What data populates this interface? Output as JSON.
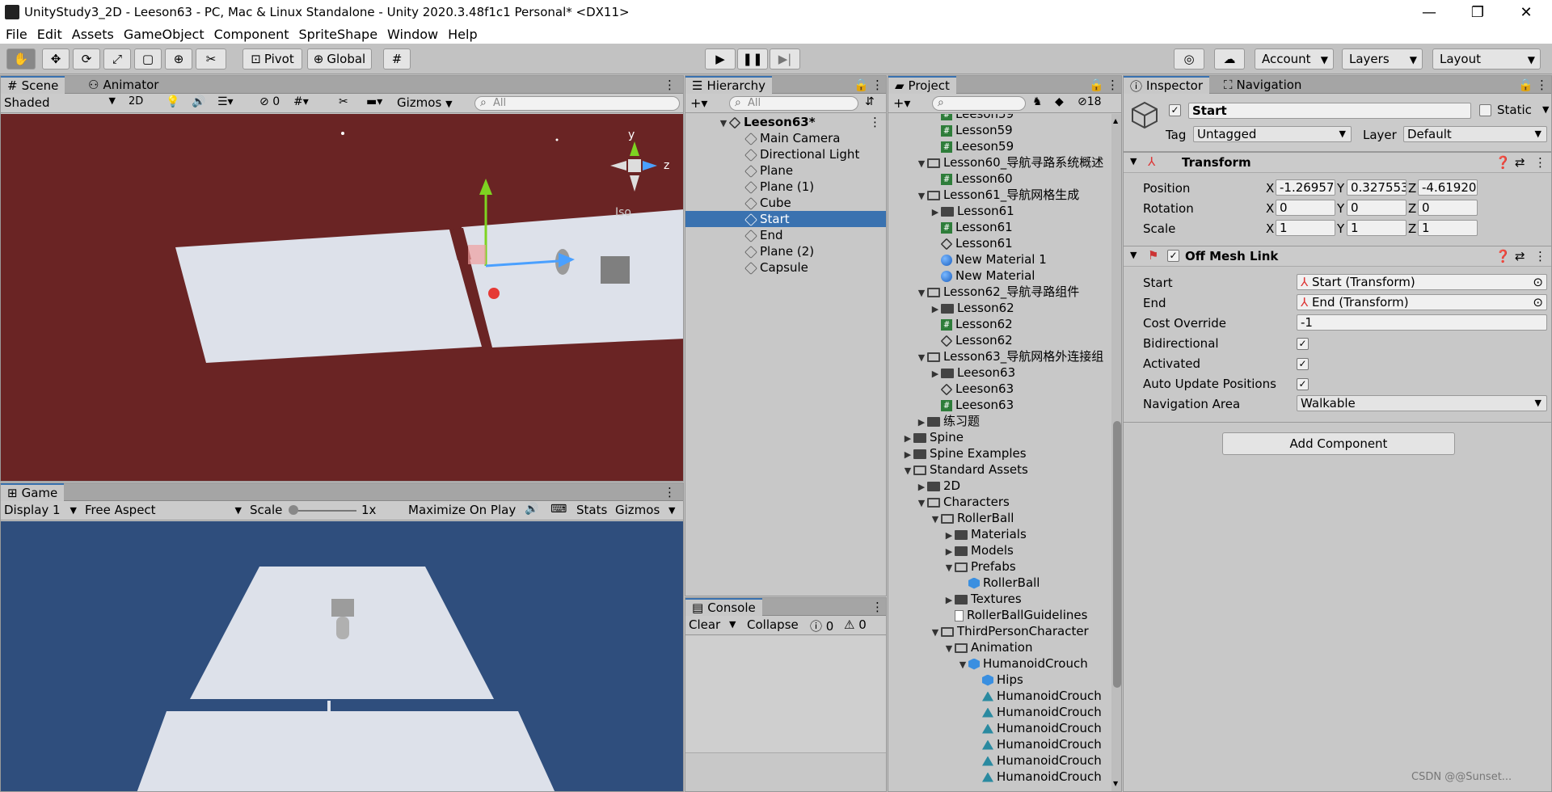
{
  "window": {
    "title": "UnityStudy3_2D - Leeson63 - PC, Mac & Linux Standalone - Unity 2020.3.48f1c1 Personal* <DX11>",
    "minimize": "—",
    "maximize": "❐",
    "close": "✕"
  },
  "menu": [
    "File",
    "Edit",
    "Assets",
    "GameObject",
    "Component",
    "SpriteShape",
    "Window",
    "Help"
  ],
  "toolbar": {
    "pivot": "Pivot",
    "global": "Global",
    "account": "Account",
    "layers": "Layers",
    "layout": "Layout"
  },
  "scene": {
    "tab_scene": "Scene",
    "tab_animator": "Animator",
    "shading": "Shaded",
    "mode2d": "2D",
    "fx_count": "0",
    "gizmos": "Gizmos",
    "search_placeholder": "All",
    "iso": "Iso",
    "axis_y": "y",
    "axis_z": "z",
    "bg_color": "#6a2424"
  },
  "game": {
    "tab": "Game",
    "display": "Display 1",
    "aspect": "Free Aspect",
    "scale_label": "Scale",
    "scale_value": "1x",
    "maximize": "Maximize On Play",
    "stats": "Stats",
    "gizmos": "Gizmos",
    "bg_color": "#2f4e7d"
  },
  "hierarchy": {
    "tab": "Hierarchy",
    "search_placeholder": "All",
    "scene_name": "Leeson63*",
    "items": [
      "Main Camera",
      "Directional Light",
      "Plane",
      "Plane (1)",
      "Cube",
      "Start",
      "End",
      "Plane (2)",
      "Capsule"
    ],
    "selected": "Start"
  },
  "console": {
    "tab": "Console",
    "clear": "Clear",
    "collapse": "Collapse",
    "errors": "0",
    "warnings": "0"
  },
  "project": {
    "tab": "Project",
    "hidden_count": "18",
    "items": [
      {
        "text": "Leeson59",
        "indent": 3,
        "icon": "ico-hash",
        "arrow": ""
      },
      {
        "text": "Lesson59",
        "indent": 3,
        "icon": "ico-hash",
        "arrow": ""
      },
      {
        "text": "Leeson59",
        "indent": 3,
        "icon": "ico-hash",
        "arrow": ""
      },
      {
        "text": "Lesson60_导航寻路系统概述",
        "indent": 2,
        "icon": "ico-folder open",
        "arrow": "▼"
      },
      {
        "text": "Lesson60",
        "indent": 3,
        "icon": "ico-hash",
        "arrow": ""
      },
      {
        "text": "Lesson61_导航网格生成",
        "indent": 2,
        "icon": "ico-folder open",
        "arrow": "▼"
      },
      {
        "text": "Lesson61",
        "indent": 3,
        "icon": "ico-folder",
        "arrow": "▶"
      },
      {
        "text": "Lesson61",
        "indent": 3,
        "icon": "ico-hash",
        "arrow": ""
      },
      {
        "text": "Lesson61",
        "indent": 3,
        "icon": "ico-unity",
        "arrow": ""
      },
      {
        "text": "New Material 1",
        "indent": 3,
        "icon": "ico-ball",
        "arrow": ""
      },
      {
        "text": "New Material",
        "indent": 3,
        "icon": "ico-ball",
        "arrow": ""
      },
      {
        "text": "Lesson62_导航寻路组件",
        "indent": 2,
        "icon": "ico-folder open",
        "arrow": "▼"
      },
      {
        "text": "Lesson62",
        "indent": 3,
        "icon": "ico-folder",
        "arrow": "▶"
      },
      {
        "text": "Lesson62",
        "indent": 3,
        "icon": "ico-hash",
        "arrow": ""
      },
      {
        "text": "Lesson62",
        "indent": 3,
        "icon": "ico-unity",
        "arrow": ""
      },
      {
        "text": "Lesson63_导航网格外连接组",
        "indent": 2,
        "icon": "ico-folder open",
        "arrow": "▼"
      },
      {
        "text": "Leeson63",
        "indent": 3,
        "icon": "ico-folder",
        "arrow": "▶"
      },
      {
        "text": "Leeson63",
        "indent": 3,
        "icon": "ico-unity",
        "arrow": ""
      },
      {
        "text": "Leeson63",
        "indent": 3,
        "icon": "ico-hash",
        "arrow": ""
      },
      {
        "text": "练习题",
        "indent": 2,
        "icon": "ico-folder",
        "arrow": "▶"
      },
      {
        "text": "Spine",
        "indent": 1,
        "icon": "ico-folder",
        "arrow": "▶"
      },
      {
        "text": "Spine Examples",
        "indent": 1,
        "icon": "ico-folder",
        "arrow": "▶"
      },
      {
        "text": "Standard Assets",
        "indent": 1,
        "icon": "ico-folder open",
        "arrow": "▼"
      },
      {
        "text": "2D",
        "indent": 2,
        "icon": "ico-folder",
        "arrow": "▶"
      },
      {
        "text": "Characters",
        "indent": 2,
        "icon": "ico-folder open",
        "arrow": "▼"
      },
      {
        "text": "RollerBall",
        "indent": 3,
        "icon": "ico-folder open",
        "arrow": "▼"
      },
      {
        "text": "Materials",
        "indent": 4,
        "icon": "ico-folder",
        "arrow": "▶"
      },
      {
        "text": "Models",
        "indent": 4,
        "icon": "ico-folder",
        "arrow": "▶"
      },
      {
        "text": "Prefabs",
        "indent": 4,
        "icon": "ico-folder open",
        "arrow": "▼"
      },
      {
        "text": "RollerBall",
        "indent": 5,
        "icon": "ico-prefab",
        "arrow": ""
      },
      {
        "text": "Textures",
        "indent": 4,
        "icon": "ico-folder",
        "arrow": "▶"
      },
      {
        "text": "RollerBallGuidelines",
        "indent": 4,
        "icon": "ico-doc",
        "arrow": ""
      },
      {
        "text": "ThirdPersonCharacter",
        "indent": 3,
        "icon": "ico-folder open",
        "arrow": "▼"
      },
      {
        "text": "Animation",
        "indent": 4,
        "icon": "ico-folder open",
        "arrow": "▼"
      },
      {
        "text": "HumanoidCrouch",
        "indent": 5,
        "icon": "ico-prefab",
        "arrow": "▼"
      },
      {
        "text": "Hips",
        "indent": 6,
        "icon": "ico-prefab",
        "arrow": ""
      },
      {
        "text": "HumanoidCrouch",
        "indent": 6,
        "icon": "ico-anim",
        "arrow": ""
      },
      {
        "text": "HumanoidCrouch",
        "indent": 6,
        "icon": "ico-anim",
        "arrow": ""
      },
      {
        "text": "HumanoidCrouch",
        "indent": 6,
        "icon": "ico-anim",
        "arrow": ""
      },
      {
        "text": "HumanoidCrouch",
        "indent": 6,
        "icon": "ico-anim",
        "arrow": ""
      },
      {
        "text": "HumanoidCrouch",
        "indent": 6,
        "icon": "ico-anim",
        "arrow": ""
      },
      {
        "text": "HumanoidCrouch",
        "indent": 6,
        "icon": "ico-anim",
        "arrow": ""
      }
    ]
  },
  "inspector": {
    "tab": "Inspector",
    "tab_nav": "Navigation",
    "object_name": "Start",
    "static_label": "Static",
    "tag_label": "Tag",
    "tag_value": "Untagged",
    "layer_label": "Layer",
    "layer_value": "Default",
    "transform": {
      "title": "Transform",
      "position_label": "Position",
      "rotation_label": "Rotation",
      "scale_label": "Scale",
      "x": "X",
      "y": "Y",
      "z": "Z",
      "position": [
        "-1.269571",
        "0.3275533",
        "-4.619208"
      ],
      "rotation": [
        "0",
        "0",
        "0"
      ],
      "scale": [
        "1",
        "1",
        "1"
      ]
    },
    "offmesh": {
      "title": "Off Mesh Link",
      "start_label": "Start",
      "start_value": "Start (Transform)",
      "end_label": "End",
      "end_value": "End (Transform)",
      "cost_label": "Cost Override",
      "cost_value": "-1",
      "bidirectional_label": "Bidirectional",
      "activated_label": "Activated",
      "auto_update_label": "Auto Update Positions",
      "navarea_label": "Navigation Area",
      "navarea_value": "Walkable"
    },
    "add_component": "Add Component"
  },
  "watermark": "CSDN @@Sunset..."
}
